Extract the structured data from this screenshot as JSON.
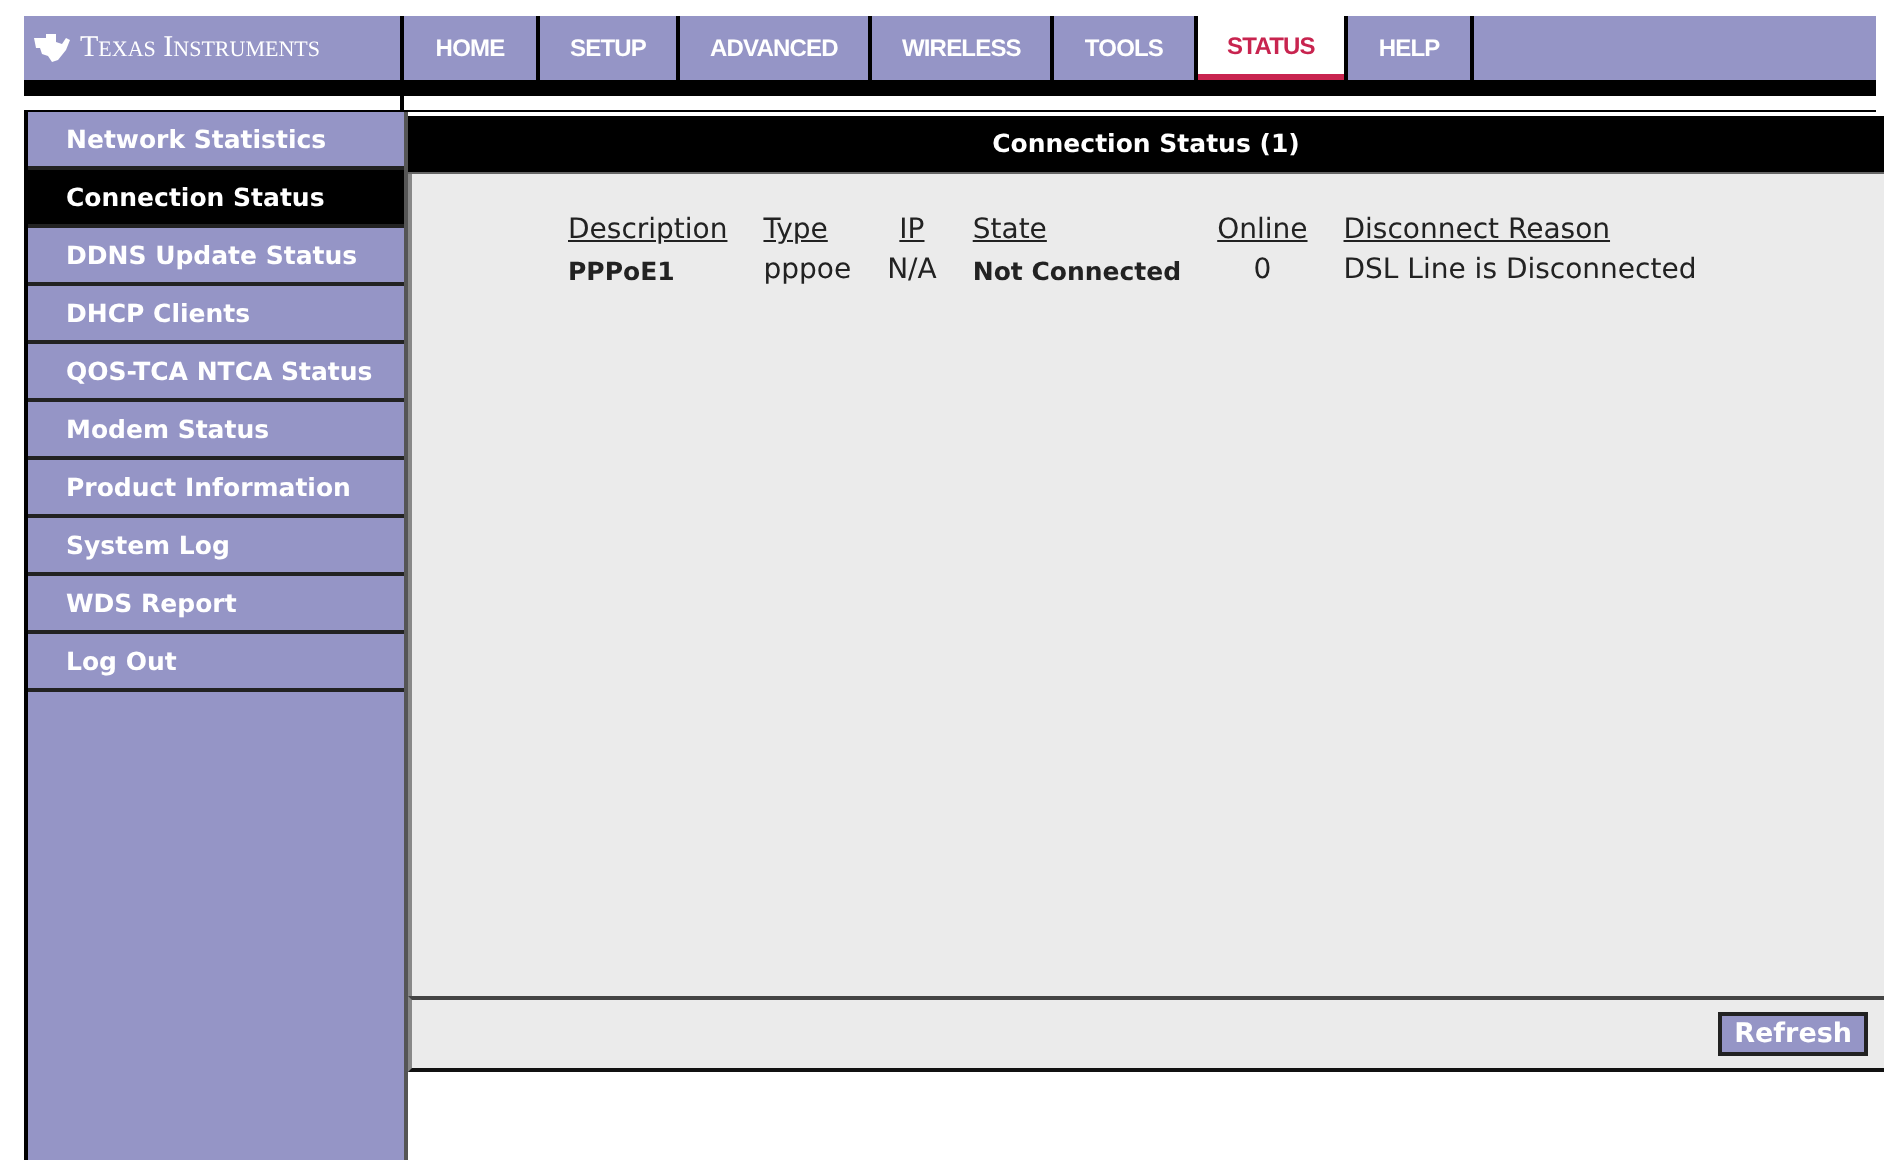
{
  "brand": {
    "name": "Texas Instruments"
  },
  "tabs": [
    {
      "label": "HOME",
      "selected": false
    },
    {
      "label": "SETUP",
      "selected": false
    },
    {
      "label": "ADVANCED",
      "selected": false
    },
    {
      "label": "WIRELESS",
      "selected": false
    },
    {
      "label": "TOOLS",
      "selected": false
    },
    {
      "label": "STATUS",
      "selected": true
    },
    {
      "label": "HELP",
      "selected": false
    }
  ],
  "sidebar": {
    "items": [
      {
        "label": "Network Statistics",
        "selected": false
      },
      {
        "label": "Connection Status",
        "selected": true
      },
      {
        "label": "DDNS Update Status",
        "selected": false
      },
      {
        "label": "DHCP Clients",
        "selected": false
      },
      {
        "label": "QOS-TCA NTCA Status",
        "selected": false
      },
      {
        "label": "Modem Status",
        "selected": false
      },
      {
        "label": "Product Information",
        "selected": false
      },
      {
        "label": "System Log",
        "selected": false
      },
      {
        "label": "WDS Report",
        "selected": false
      },
      {
        "label": "Log Out",
        "selected": false
      }
    ]
  },
  "panel": {
    "title": "Connection Status (1)"
  },
  "table": {
    "columns": [
      "Description",
      "Type",
      "IP",
      "State",
      "Online",
      "Disconnect Reason"
    ],
    "rows": [
      [
        "PPPoE1",
        "pppoe",
        "N/A",
        "Not Connected",
        "0",
        "DSL Line is Disconnected"
      ]
    ]
  },
  "buttons": [
    "Refresh"
  ]
}
